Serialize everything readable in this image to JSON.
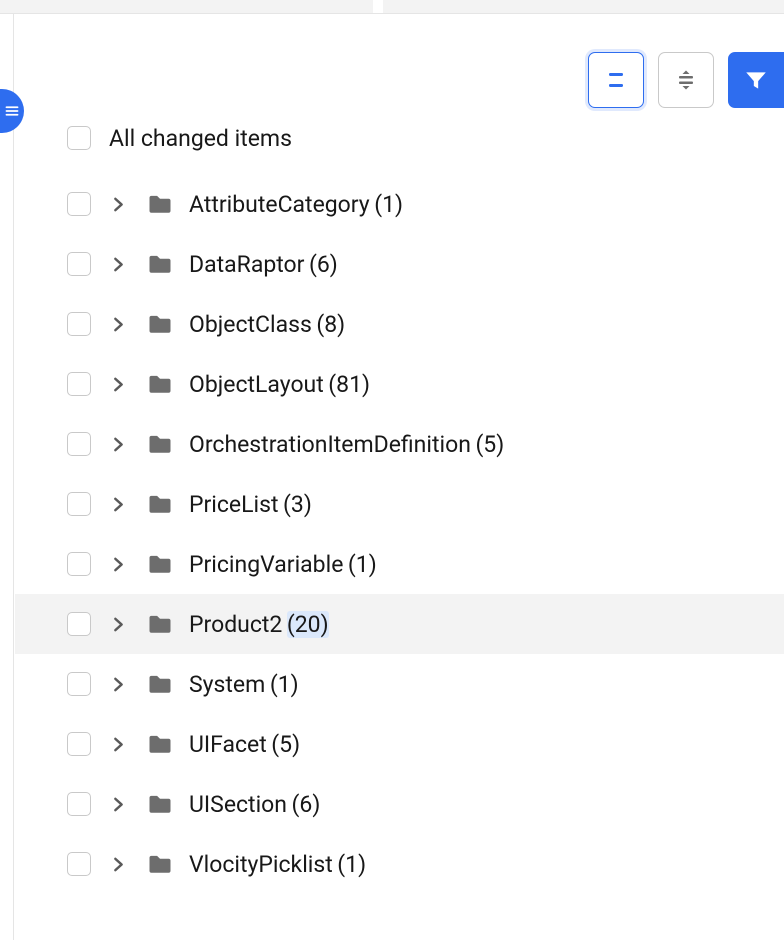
{
  "header": {
    "title": "All changed items"
  },
  "items": [
    {
      "name": "AttributeCategory",
      "count": 1,
      "highlight": false
    },
    {
      "name": "DataRaptor",
      "count": 6,
      "highlight": false
    },
    {
      "name": "ObjectClass",
      "count": 8,
      "highlight": false
    },
    {
      "name": "ObjectLayout",
      "count": 81,
      "highlight": false
    },
    {
      "name": "OrchestrationItemDefinition",
      "count": 5,
      "highlight": false
    },
    {
      "name": "PriceList",
      "count": 3,
      "highlight": false
    },
    {
      "name": "PricingVariable",
      "count": 1,
      "highlight": false
    },
    {
      "name": "Product2",
      "count": 20,
      "highlight": true
    },
    {
      "name": "System",
      "count": 1,
      "highlight": false
    },
    {
      "name": "UIFacet",
      "count": 5,
      "highlight": false
    },
    {
      "name": "UISection",
      "count": 6,
      "highlight": false
    },
    {
      "name": "VlocityPicklist",
      "count": 1,
      "highlight": false
    }
  ]
}
